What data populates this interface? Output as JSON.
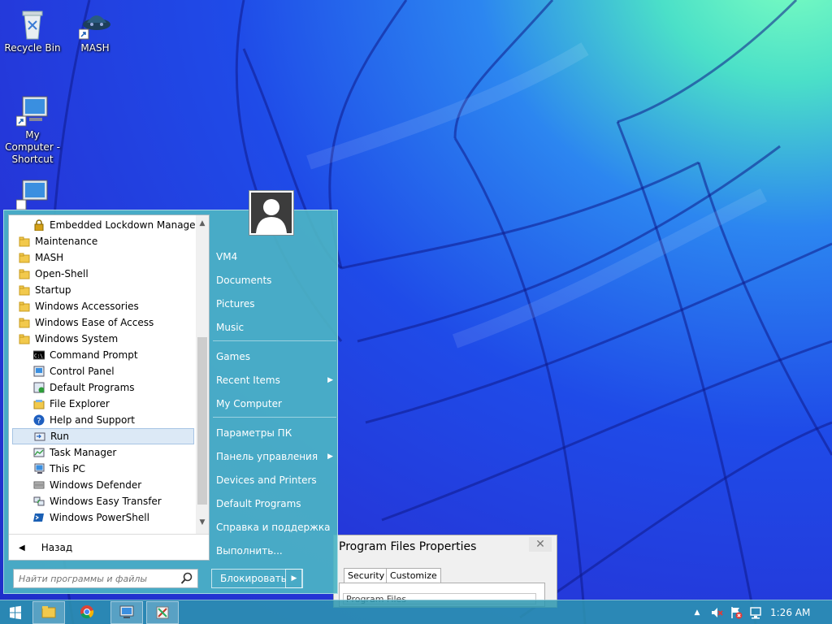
{
  "desktop": {
    "icons": [
      {
        "label": "Recycle Bin",
        "icon": "recycle-bin-icon"
      },
      {
        "label": "MASH",
        "icon": "mash-shortcut-icon"
      },
      {
        "label": "My Computer - Shortcut",
        "icon": "computer-shortcut-icon"
      },
      {
        "label": "",
        "icon": "computer-icon"
      }
    ]
  },
  "start_menu": {
    "programs": [
      {
        "label": "Embedded Lockdown Manager",
        "icon": "lock-icon"
      },
      {
        "label": "Maintenance",
        "icon": "folder-icon"
      },
      {
        "label": "MASH",
        "icon": "folder-icon"
      },
      {
        "label": "Open-Shell",
        "icon": "folder-icon"
      },
      {
        "label": "Startup",
        "icon": "folder-icon"
      },
      {
        "label": "Windows Accessories",
        "icon": "folder-icon"
      },
      {
        "label": "Windows Ease of Access",
        "icon": "folder-icon"
      },
      {
        "label": "Windows System",
        "icon": "folder-icon"
      },
      {
        "label": "Command Prompt",
        "icon": "command-prompt-icon"
      },
      {
        "label": "Control Panel",
        "icon": "control-panel-icon"
      },
      {
        "label": "Default Programs",
        "icon": "default-programs-icon"
      },
      {
        "label": "File Explorer",
        "icon": "file-explorer-icon"
      },
      {
        "label": "Help and Support",
        "icon": "help-icon"
      },
      {
        "label": "Run",
        "icon": "run-icon"
      },
      {
        "label": "Task Manager",
        "icon": "task-manager-icon"
      },
      {
        "label": "This PC",
        "icon": "this-pc-icon"
      },
      {
        "label": "Windows Defender",
        "icon": "defender-icon"
      },
      {
        "label": "Windows Easy Transfer",
        "icon": "easy-transfer-icon"
      },
      {
        "label": "Windows PowerShell",
        "icon": "powershell-icon"
      }
    ],
    "selected_program": "Run",
    "back_label": "Назад",
    "search_placeholder": "Найти программы и файлы",
    "right_items": [
      {
        "label": "VM4",
        "submenu": false
      },
      {
        "label": "Documents",
        "submenu": false
      },
      {
        "label": "Pictures",
        "submenu": false
      },
      {
        "label": "Music",
        "submenu": false
      },
      {
        "label": "Games",
        "submenu": false
      },
      {
        "label": "Recent Items",
        "submenu": true
      },
      {
        "label": "My Computer",
        "submenu": false
      },
      {
        "label": "Параметры ПК",
        "submenu": false
      },
      {
        "label": "Панель управления",
        "submenu": true
      },
      {
        "label": "Devices and Printers",
        "submenu": false
      },
      {
        "label": "Default Programs",
        "submenu": false
      },
      {
        "label": "Справка и поддержка",
        "submenu": false
      },
      {
        "label": "Выполнить...",
        "submenu": false
      }
    ],
    "shutdown_label": "Блокировать"
  },
  "properties_window": {
    "title": "Program Files Properties",
    "tabs": [
      "Security",
      "Customize"
    ],
    "field_value": "Program Files"
  },
  "taskbar": {
    "apps": [
      "file-explorer-icon",
      "chrome-icon",
      "remote-desktop-icon",
      "tools-icon"
    ],
    "clock": "1:26 AM"
  },
  "colors": {
    "menu_bg": "#4cb4c4",
    "selection": "#dce9f6",
    "taskbar": "#2d96af"
  }
}
